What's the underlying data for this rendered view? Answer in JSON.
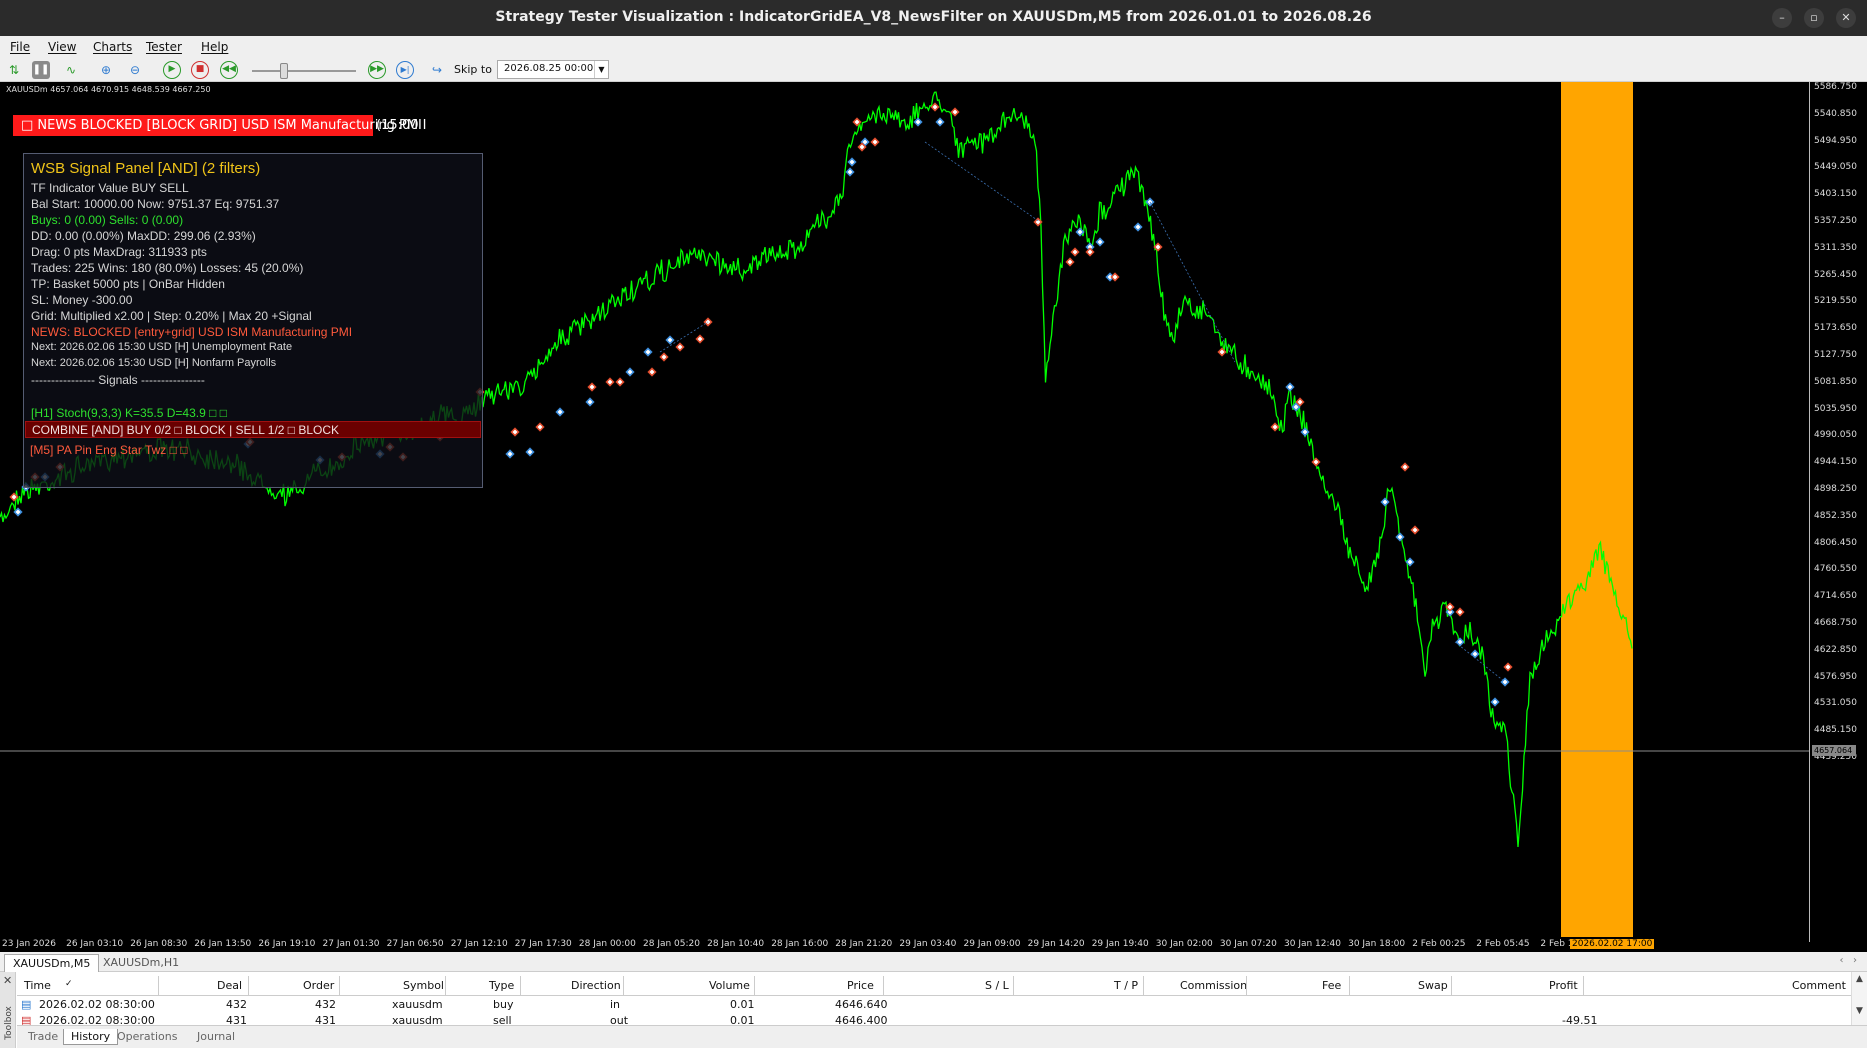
{
  "window": {
    "title": "Strategy Tester Visualization : IndicatorGridEA_V8_NewsFilter on XAUUSDm,M5 from 2026.01.01 to 2026.08.26",
    "minimize": "–",
    "restore": "▫",
    "close": "✕"
  },
  "menu": {
    "file": "File",
    "view": "View",
    "charts": "Charts",
    "tester": "Tester",
    "help": "Help"
  },
  "toolbar": {
    "skip_label": "Skip to",
    "skip_value": "2026.08.25 00:00"
  },
  "chart": {
    "symbol_info": "XAUUSDm  4657.064 4670.915 4648.539 4667.250",
    "news_banner": "□ NEWS BLOCKED [BLOCK GRID] USD ISM Manufacturing PMI",
    "news_tail": "(15:00 I",
    "current_price": "4657.064",
    "price_labels": [
      "5586.750",
      "5540.850",
      "5494.950",
      "5449.050",
      "5403.150",
      "5357.250",
      "5311.350",
      "5265.450",
      "5219.550",
      "5173.650",
      "5127.750",
      "5081.850",
      "5035.950",
      "4990.050",
      "4944.150",
      "4898.250",
      "4852.350",
      "4806.450",
      "4760.550",
      "4714.650",
      "4668.750",
      "4622.850",
      "4576.950",
      "4531.050",
      "4485.150",
      "4439.250"
    ],
    "time_labels": [
      "23 Jan 2026",
      "26 Jan 03:10",
      "26 Jan 08:30",
      "26 Jan 13:50",
      "26 Jan 19:10",
      "27 Jan 01:30",
      "27 Jan 06:50",
      "27 Jan 12:10",
      "27 Jan 17:30",
      "28 Jan 00:00",
      "28 Jan 05:20",
      "28 Jan 10:40",
      "28 Jan 16:00",
      "28 Jan 21:20",
      "29 Jan 03:40",
      "29 Jan 09:00",
      "29 Jan 14:20",
      "29 Jan 19:40",
      "30 Jan 02:00",
      "30 Jan 07:20",
      "30 Jan 12:40",
      "30 Jan 18:00",
      "2 Feb 00:25",
      "2 Feb 05:45",
      "2 Feb 1"
    ],
    "time_highlight": "2026.02.02 17:00",
    "colors": {
      "price_line": "#00ff00",
      "highlight": "#ffa500",
      "buy_marker": "#3a8dde",
      "sell_marker": "#e24a2a"
    }
  },
  "panel": {
    "title": "WSB Signal Panel  [AND]  (2 filters)",
    "header": "TF  Indicator              Value                 BUY  SELL",
    "bal": "Bal Start: 10000.00  Now: 9751.37  Eq: 9751.37",
    "buys_sells": "Buys: 0 (0.00)  Sells: 0 (0.00)",
    "dd": "DD: 0.00 (0.00%)  MaxDD: 299.06 (2.93%)",
    "drag": "Drag: 0 pts  MaxDrag: 311933 pts",
    "trades": "Trades: 225  Wins: 180 (80.0%)  Losses: 45 (20.0%)",
    "tp": "TP: Basket 5000 pts | OnBar Hidden",
    "sl": "SL: Money -300.00",
    "grid": "Grid: Multiplied x2.00 | Step: 0.20% | Max 20 +Signal",
    "news": "NEWS: BLOCKED [entry+grid] USD ISM Manufacturing PMI",
    "next1": "Next: 2026.02.06 15:30 USD [H] Unemployment Rate",
    "next2": "Next: 2026.02.06 15:30 USD [H] Nonfarm Payrolls",
    "signals_sep": "---------------- Signals ----------------",
    "sig1": "[H1] Stoch(9,3,3)  K=35.5 D=43.9   □   □",
    "sig2": "[M5] PA Pin Eng Star Twz        □    □",
    "combine": "COMBINE [AND]  BUY 0/2 □ BLOCK  |  SELL 1/2 □ BLOCK"
  },
  "chart_tabs": [
    "XAUUSDm,M5",
    "XAUUSDm,H1"
  ],
  "history": {
    "columns": [
      "Time",
      "Deal",
      "Order",
      "Symbol",
      "Type",
      "Direction",
      "Volume",
      "Price",
      "S / L",
      "T / P",
      "Commission",
      "Fee",
      "Swap",
      "Profit",
      "Comment"
    ],
    "rows": [
      {
        "time": "2026.02.02 08:30:00",
        "deal": "432",
        "order": "432",
        "symbol": "xauusdm",
        "type": "buy",
        "direction": "in",
        "volume": "0.01",
        "price": "4646.640",
        "profit": ""
      },
      {
        "time": "2026.02.02 08:30:00",
        "deal": "431",
        "order": "431",
        "symbol": "xauusdm",
        "type": "sell",
        "direction": "out",
        "volume": "0.01",
        "price": "4646.400",
        "profit": "-49.51"
      }
    ]
  },
  "bottom_tabs": [
    "Trade",
    "History",
    "Operations",
    "Journal"
  ],
  "toolbox_label": "Toolbox"
}
